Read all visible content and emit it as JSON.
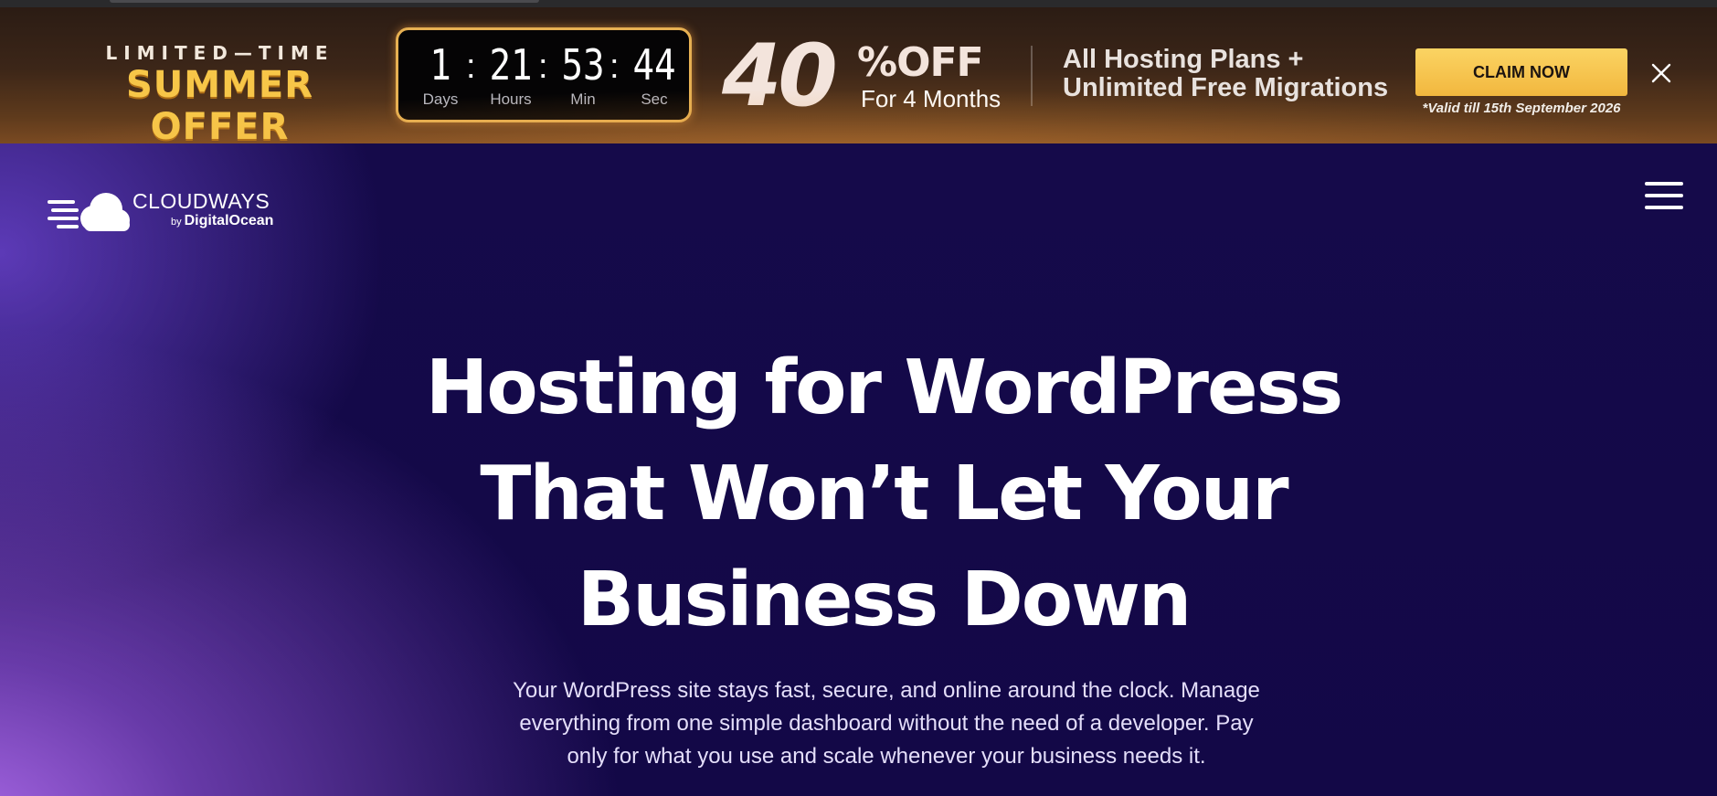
{
  "promo": {
    "tagline_small": "LIMITED—TIME",
    "tagline_big": "SUMMER OFFER",
    "countdown": [
      {
        "value": "1",
        "label": "Days"
      },
      {
        "value": "21",
        "label": "Hours"
      },
      {
        "value": "53",
        "label": "Min"
      },
      {
        "value": "44",
        "label": "Sec"
      }
    ],
    "separator": ":",
    "discount_number": "40",
    "discount_suffix": "%OFF",
    "discount_duration": "For 4 Months",
    "plans_line1": "All Hosting Plans +",
    "plans_line2": "Unlimited Free Migrations",
    "cta_label": "CLAIM NOW",
    "validity": "*Valid till 15th September 2026",
    "colors": {
      "accent_gold": "#f7c648",
      "button": "#f6c24d"
    }
  },
  "header": {
    "logo_name": "CLOUDWAYS",
    "logo_by": "by",
    "logo_parent": "DigitalOcean"
  },
  "hero": {
    "title_line1": "Hosting for WordPress",
    "title_line2": "That Won’t Let Your",
    "title_line3": "Business Down",
    "subtitle_line1": "Your WordPress site stays fast, secure, and online around the clock. Manage",
    "subtitle_line2": "everything from one simple dashboard without the need of a developer. Pay",
    "subtitle_line3": "only for what you use and scale whenever your business needs it."
  },
  "icons": {
    "close": "close-icon",
    "menu": "hamburger-menu-icon",
    "logo": "cloud-logo-icon"
  }
}
